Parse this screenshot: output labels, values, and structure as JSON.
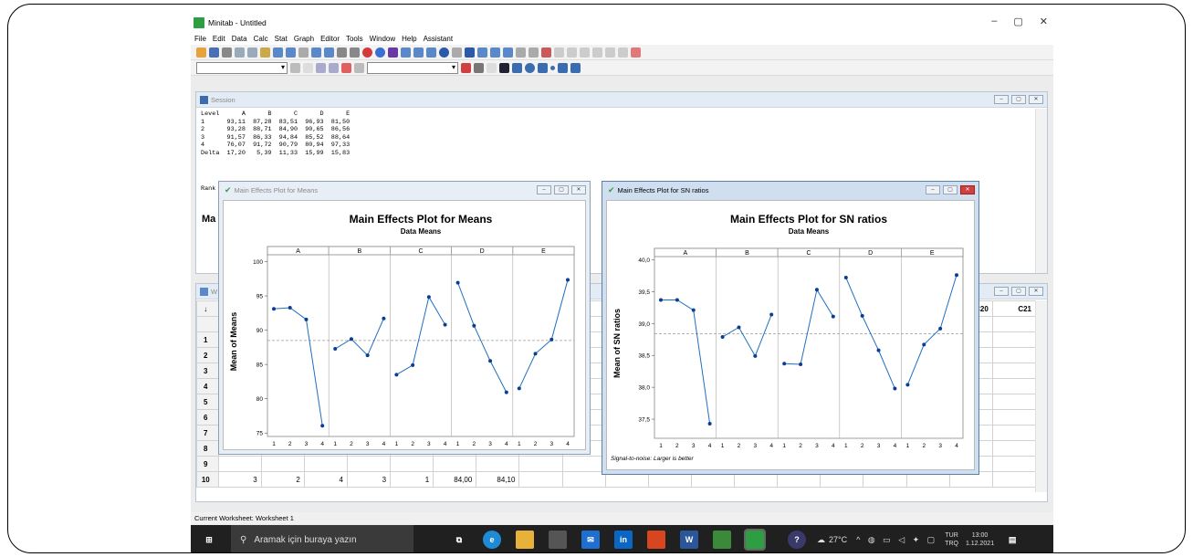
{
  "app": {
    "title": "Minitab - Untitled"
  },
  "window_controls": {
    "minimize": "–",
    "maximize": "▢",
    "close": "✕"
  },
  "menu": [
    "File",
    "Edit",
    "Data",
    "Calc",
    "Stat",
    "Graph",
    "Editor",
    "Tools",
    "Window",
    "Help",
    "Assistant"
  ],
  "session": {
    "title": "Session",
    "table_text": "Level      A      B      C      D      E\n1      93,11  87,28  83,51  96,93  81,50\n2      93,28  88,71  84,90  90,65  86,56\n3      91,57  86,33  94,84  85,52  88,64\n4      76,07  91,72  90,79  80,94  97,33\nDelta  17,20   5,39  11,33  15,99  15,83",
    "rank_label": "Rank",
    "heading_partial": "Ma"
  },
  "worksheet": {
    "title_partial": "W",
    "cols": [
      "C20",
      "C21"
    ],
    "col_partial": "D",
    "rows": [
      "1",
      "2",
      "3",
      "4",
      "5",
      "6",
      "7",
      "8",
      "9",
      "10"
    ],
    "row10": {
      "c1": "3",
      "c2": "2",
      "c3": "4",
      "c4": "3",
      "c5": "1",
      "c6": "84,00",
      "c7": "84,10"
    }
  },
  "plot_means": {
    "window_title": "Main Effects Plot for Means",
    "title": "Main Effects Plot for Means",
    "subtitle": "Data Means",
    "ylabel": "Mean of Means"
  },
  "plot_sn": {
    "window_title": "Main Effects Plot for SN ratios",
    "title": "Main Effects Plot for SN ratios",
    "subtitle": "Data Means",
    "ylabel": "Mean of SN ratios",
    "footnote": "Signal-to-noise: Larger is better"
  },
  "chart_data": [
    {
      "type": "line",
      "title": "Main Effects Plot for Means",
      "subtitle": "Data Means",
      "ylabel": "Mean of Means",
      "panels": [
        "A",
        "B",
        "C",
        "D",
        "E"
      ],
      "x": [
        "1",
        "2",
        "3",
        "4"
      ],
      "series": [
        {
          "name": "A",
          "values": [
            93.11,
            93.28,
            91.57,
            76.07
          ]
        },
        {
          "name": "B",
          "values": [
            87.28,
            88.71,
            86.33,
            91.72
          ]
        },
        {
          "name": "C",
          "values": [
            83.51,
            84.9,
            94.84,
            90.79
          ]
        },
        {
          "name": "D",
          "values": [
            96.93,
            90.65,
            85.52,
            80.94
          ]
        },
        {
          "name": "E",
          "values": [
            81.5,
            86.56,
            88.64,
            97.33
          ]
        }
      ],
      "reference_mean": 88.5,
      "ylim": [
        74.5,
        101
      ],
      "yticks": [
        "75",
        "80",
        "85",
        "90",
        "95",
        "100"
      ]
    },
    {
      "type": "line",
      "title": "Main Effects Plot for SN ratios",
      "subtitle": "Data Means",
      "ylabel": "Mean of SN ratios",
      "panels": [
        "A",
        "B",
        "C",
        "D",
        "E"
      ],
      "x": [
        "1",
        "2",
        "3",
        "4"
      ],
      "series": [
        {
          "name": "A",
          "values": [
            39.37,
            39.37,
            39.21,
            37.43
          ]
        },
        {
          "name": "B",
          "values": [
            38.79,
            38.94,
            38.49,
            39.14
          ]
        },
        {
          "name": "C",
          "values": [
            38.37,
            38.36,
            39.53,
            39.11
          ]
        },
        {
          "name": "D",
          "values": [
            39.72,
            39.12,
            38.58,
            37.98
          ]
        },
        {
          "name": "E",
          "values": [
            38.04,
            38.67,
            38.92,
            39.76
          ]
        }
      ],
      "reference_mean": 38.84,
      "ylim": [
        37.2,
        40.05
      ],
      "yticks": [
        "37,5",
        "38,0",
        "38,5",
        "39,0",
        "39,5",
        "40,0"
      ]
    }
  ],
  "statusbar": {
    "text": "Current Worksheet: Worksheet 1"
  },
  "taskbar": {
    "search_placeholder": "Aramak için buraya yazın",
    "weather": "27°C",
    "lang_top": "TUR",
    "lang_bottom": "TRQ",
    "time": "13:00",
    "date": "1.12.2021"
  }
}
